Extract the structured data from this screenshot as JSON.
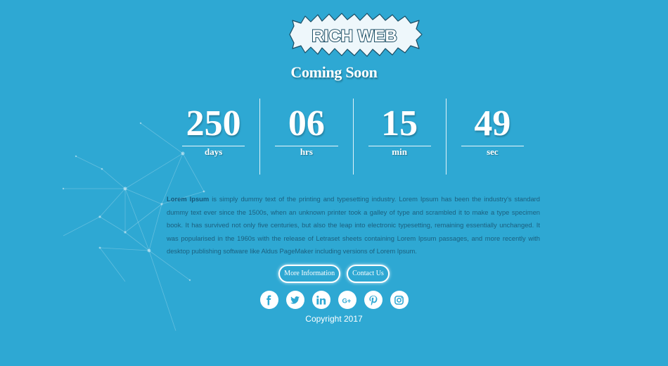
{
  "logo": {
    "text": "RICH WEB"
  },
  "page": {
    "title": "Coming Soon"
  },
  "countdown": [
    {
      "value": "250",
      "label": "days"
    },
    {
      "value": "06",
      "label": "hrs"
    },
    {
      "value": "15",
      "label": "min"
    },
    {
      "value": "49",
      "label": "sec"
    }
  ],
  "description": {
    "lead": "Lorem Ipsum",
    "body": " is simply dummy text of the printing and typesetting industry. Lorem Ipsum has been the industry's standard dummy text ever since the 1500s, when an unknown printer took a galley of type and scrambled it to make a type specimen book. It has survived not only five centuries, but also the leap into electronic typesetting, remaining essentially unchanged. It was popularised in the 1960s with the release of Letraset sheets containing Lorem Ipsum passages, and more recently with desktop publishing software like Aldus PageMaker including versions of Lorem Ipsum."
  },
  "buttons": {
    "more_info": "More Information",
    "contact": "Contact Us"
  },
  "social": [
    "facebook-icon",
    "twitter-icon",
    "linkedin-icon",
    "google-plus-icon",
    "pinterest-icon",
    "instagram-icon"
  ],
  "footer": {
    "copyright": "Copyright 2017"
  },
  "colors": {
    "background": "#2ea8d3",
    "text_dark": "#1b5f7e",
    "white": "#ffffff"
  }
}
